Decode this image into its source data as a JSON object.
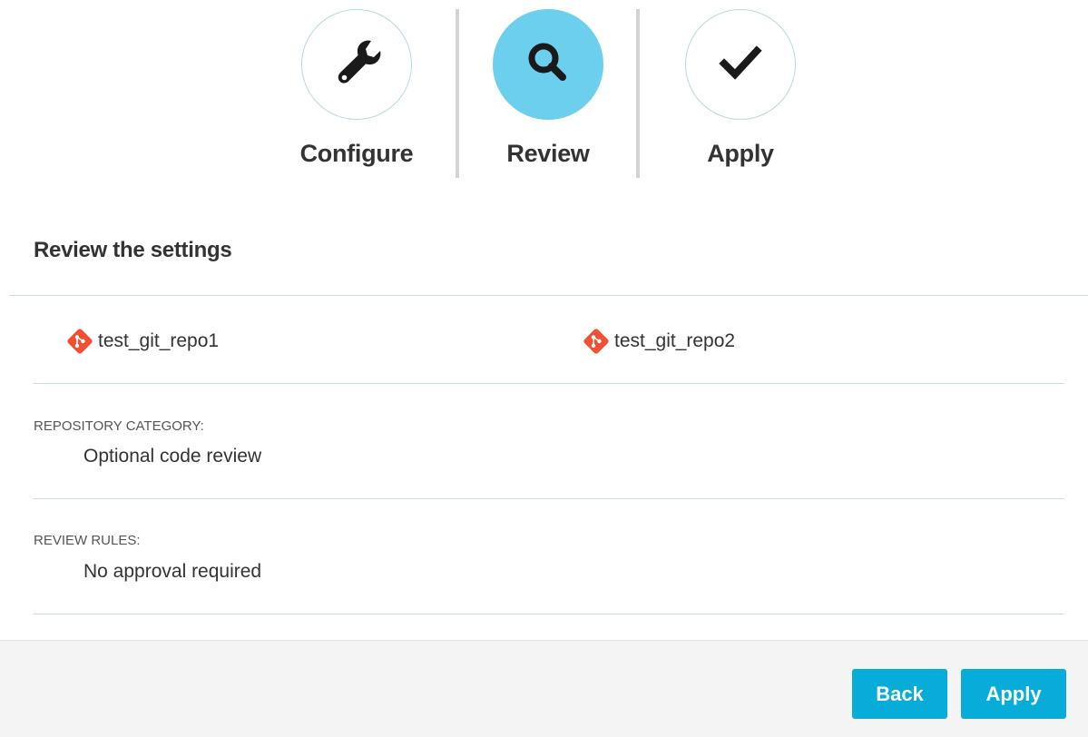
{
  "wizard": {
    "steps": [
      {
        "label": "Configure",
        "icon": "wrench-icon",
        "active": false
      },
      {
        "label": "Review",
        "icon": "search-icon",
        "active": true
      },
      {
        "label": "Apply",
        "icon": "checkmark-icon",
        "active": false
      }
    ]
  },
  "review": {
    "title": "Review the settings",
    "repositories": [
      {
        "name": "test_git_repo1",
        "icon": "git-icon"
      },
      {
        "name": "test_git_repo2",
        "icon": "git-icon"
      }
    ],
    "fields": [
      {
        "label": "REPOSITORY CATEGORY:",
        "value": "Optional code review"
      },
      {
        "label": "REVIEW RULES:",
        "value": "No approval required"
      }
    ]
  },
  "footer": {
    "back_label": "Back",
    "apply_label": "Apply"
  },
  "colors": {
    "accent": "#08acd9",
    "active_step": "#6ccfee",
    "git_brand": "#f05033"
  }
}
